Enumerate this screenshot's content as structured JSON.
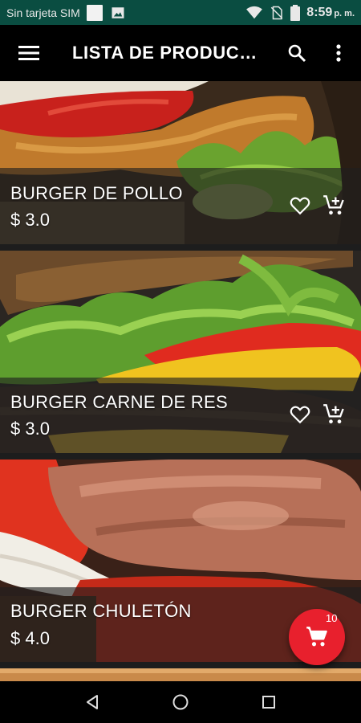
{
  "status_bar": {
    "carrier": "Sin tarjeta SIM",
    "time": "8:59",
    "ampm": "p. m.",
    "icons": [
      "notification-square-icon",
      "image-icon",
      "wifi-icon",
      "no-sim-icon",
      "battery-icon"
    ]
  },
  "app_bar": {
    "title": "LISTA DE PRODUCTOS",
    "icons": [
      "menu-icon",
      "search-icon",
      "more-vert-icon"
    ]
  },
  "products": [
    {
      "name": "BURGER DE POLLO",
      "price": "$ 3.0"
    },
    {
      "name": "BURGER CARNE DE RES",
      "price": "$ 3.0"
    },
    {
      "name": "BURGER CHULETÓN",
      "price": "$ 4.0"
    }
  ],
  "cart": {
    "count": "10",
    "icon": "shopping-cart-icon",
    "color": "#e8202d"
  },
  "nav_bar": {
    "icons": [
      "back-icon",
      "home-icon",
      "recents-icon"
    ]
  },
  "colors": {
    "status_bar": "#0a4d41",
    "app_bar": "#000000",
    "accent": "#e8202d"
  }
}
